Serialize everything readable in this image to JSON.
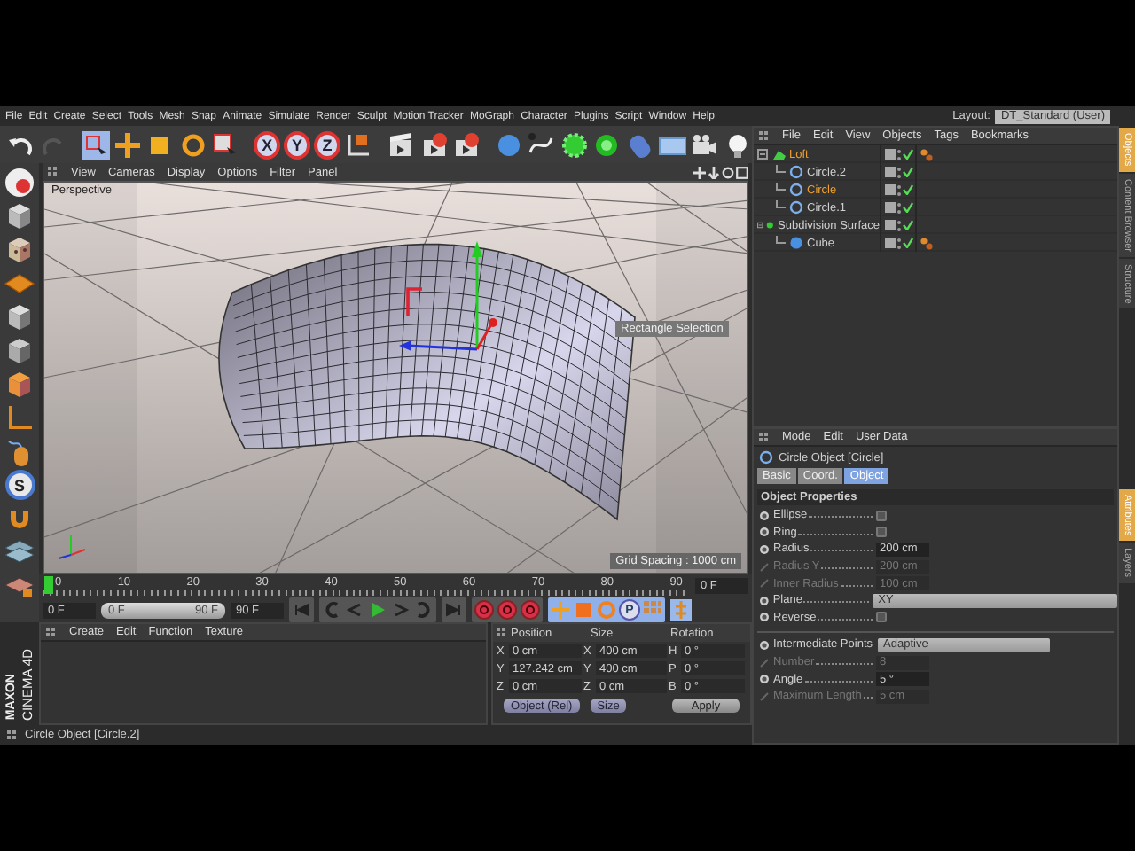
{
  "menu_bar": {
    "items": [
      "File",
      "Edit",
      "Create",
      "Select",
      "Tools",
      "Mesh",
      "Snap",
      "Animate",
      "Simulate",
      "Render",
      "Sculpt",
      "Motion Tracker",
      "MoGraph",
      "Character",
      "Plugins",
      "Script",
      "Window",
      "Help"
    ],
    "layout_label": "Layout:",
    "layout_value": "DT_Standard (User)"
  },
  "toolbar": {
    "axis_buttons": [
      "X",
      "Y",
      "Z"
    ]
  },
  "left_toolbar": {
    "snap_letter": "S"
  },
  "viewport": {
    "menu": [
      "View",
      "Cameras",
      "Display",
      "Options",
      "Filter",
      "Panel"
    ],
    "camera": "Perspective",
    "tooltip": "Rectangle Selection",
    "grid_spacing": "Grid Spacing : 1000 cm"
  },
  "timeline": {
    "ticks": [
      "0",
      "10",
      "20",
      "30",
      "40",
      "50",
      "60",
      "70",
      "80",
      "90"
    ],
    "current_frame_field": "0 F",
    "start_field": "0 F",
    "range": {
      "start": "0 F",
      "end": "90 F"
    },
    "end_field": "90 F",
    "key_letter": "P"
  },
  "materials": {
    "menu": [
      "Create",
      "Edit",
      "Function",
      "Texture"
    ]
  },
  "coordinates": {
    "headers": [
      "Position",
      "Size",
      "Rotation"
    ],
    "rows": [
      {
        "axis": "X",
        "position": "0 cm",
        "size_axis": "X",
        "size": "400 cm",
        "rotation_axis": "H",
        "rotation": "0 °"
      },
      {
        "axis": "Y",
        "position": "127.242 cm",
        "size_axis": "Y",
        "size": "400 cm",
        "rotation_axis": "P",
        "rotation": "0 °"
      },
      {
        "axis": "Z",
        "position": "0 cm",
        "size_axis": "Z",
        "size": "0 cm",
        "rotation_axis": "B",
        "rotation": "0 °"
      }
    ],
    "mode": "Object (Rel)",
    "size_mode": "Size",
    "apply": "Apply"
  },
  "logo": {
    "brand": "MAXON",
    "product": "CINEMA 4D"
  },
  "status_bar": "Circle Object [Circle.2]",
  "object_manager": {
    "menu": [
      "File",
      "Edit",
      "View",
      "Objects",
      "Tags",
      "Bookmarks"
    ],
    "tree": [
      {
        "name": "Loft",
        "kind": "loft",
        "selected": true,
        "tag": true,
        "children": [
          {
            "name": "Circle.2",
            "kind": "circle",
            "selected": false,
            "tag": false
          },
          {
            "name": "Circle",
            "kind": "circle",
            "selected": true,
            "tag": false
          },
          {
            "name": "Circle.1",
            "kind": "circle",
            "selected": false,
            "tag": false
          }
        ]
      },
      {
        "name": "Subdivision Surface",
        "kind": "subdivision",
        "selected": false,
        "tag": false,
        "children": [
          {
            "name": "Cube",
            "kind": "cube",
            "selected": false,
            "tag": true
          }
        ]
      }
    ]
  },
  "attributes": {
    "menu": [
      "Mode",
      "Edit",
      "User Data"
    ],
    "title": "Circle Object [Circle]",
    "tabs": [
      {
        "label": "Basic",
        "selected": false
      },
      {
        "label": "Coord.",
        "selected": false
      },
      {
        "label": "Object",
        "selected": true
      }
    ],
    "section": "Object Properties",
    "params": [
      {
        "kind": "checkbox",
        "label": "Ellipse",
        "checked": false
      },
      {
        "kind": "checkbox",
        "label": "Ring",
        "checked": false
      },
      {
        "kind": "number",
        "label": "Radius",
        "value": "200 cm",
        "disabled": false
      },
      {
        "kind": "number",
        "label": "Radius Y",
        "value": "200 cm",
        "disabled": true
      },
      {
        "kind": "number",
        "label": "Inner Radius",
        "value": "100 cm",
        "disabled": true
      },
      {
        "kind": "dropdown",
        "label": "Plane",
        "value": "XY"
      },
      {
        "kind": "checkbox",
        "label": "Reverse",
        "checked": false
      },
      {
        "kind": "separator"
      },
      {
        "kind": "dropdown",
        "label": "Intermediate Points",
        "value": "Adaptive"
      },
      {
        "kind": "number",
        "label": "Number",
        "value": "8",
        "disabled": true
      },
      {
        "kind": "number",
        "label": "Angle",
        "value": "5 °",
        "disabled": false
      },
      {
        "kind": "number",
        "label": "Maximum Length",
        "value": "5 cm",
        "disabled": true
      }
    ]
  },
  "side_tabs_top": [
    {
      "label": "Objects",
      "selected": true
    },
    {
      "label": "Content Browser",
      "selected": false
    },
    {
      "label": "Structure",
      "selected": false
    }
  ],
  "side_tabs_bottom": [
    {
      "label": "Attributes",
      "selected": true
    },
    {
      "label": "Layers",
      "selected": false
    }
  ]
}
